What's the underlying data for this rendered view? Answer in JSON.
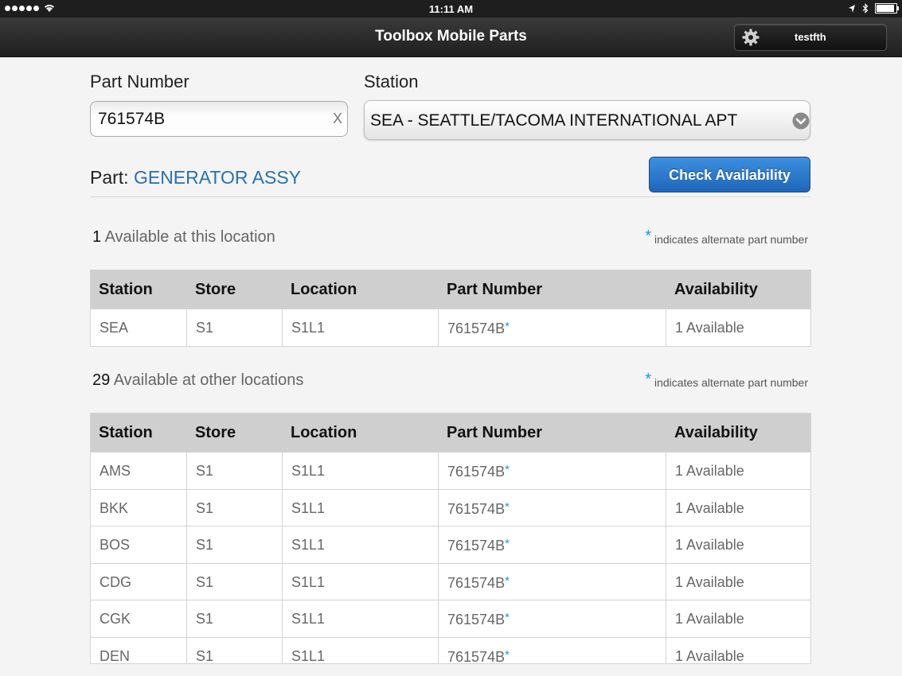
{
  "status_bar": {
    "time": "11:11 AM"
  },
  "nav": {
    "title": "Toolbox Mobile Parts",
    "user": "testfth"
  },
  "form": {
    "part_number_label": "Part Number",
    "part_number_value": "761574B",
    "clear_label": "X",
    "station_label": "Station",
    "station_value": "SEA - SEATTLE/TACOMA INTERNATIONAL APT",
    "part_prefix": "Part:",
    "part_name": "GENERATOR ASSY",
    "check_button": "Check Availability"
  },
  "colors": {
    "accent": "#2a6fae",
    "button": "#2a78c9",
    "star": "#1a9ad9"
  },
  "columns": [
    "Station",
    "Store",
    "Location",
    "Part Number",
    "Availability"
  ],
  "local": {
    "count": "1",
    "title": "Available at this location",
    "note_star": "*",
    "note": "indicates alternate part number",
    "rows": [
      {
        "station": "SEA",
        "store": "S1",
        "location": "S1L1",
        "part": "761574B",
        "star": "*",
        "availability": "1 Available"
      }
    ]
  },
  "other": {
    "count": "29",
    "title": "Available at other locations",
    "note_star": "*",
    "note": "indicates alternate part number",
    "rows": [
      {
        "station": "AMS",
        "store": "S1",
        "location": "S1L1",
        "part": "761574B",
        "star": "*",
        "availability": "1 Available"
      },
      {
        "station": "BKK",
        "store": "S1",
        "location": "S1L1",
        "part": "761574B",
        "star": "*",
        "availability": "1 Available"
      },
      {
        "station": "BOS",
        "store": "S1",
        "location": "S1L1",
        "part": "761574B",
        "star": "*",
        "availability": "1 Available"
      },
      {
        "station": "CDG",
        "store": "S1",
        "location": "S1L1",
        "part": "761574B",
        "star": "*",
        "availability": "1 Available"
      },
      {
        "station": "CGK",
        "store": "S1",
        "location": "S1L1",
        "part": "761574B",
        "star": "*",
        "availability": "1 Available"
      },
      {
        "station": "DEN",
        "store": "S1",
        "location": "S1L1",
        "part": "761574B",
        "star": "*",
        "availability": "1 Available"
      }
    ]
  }
}
